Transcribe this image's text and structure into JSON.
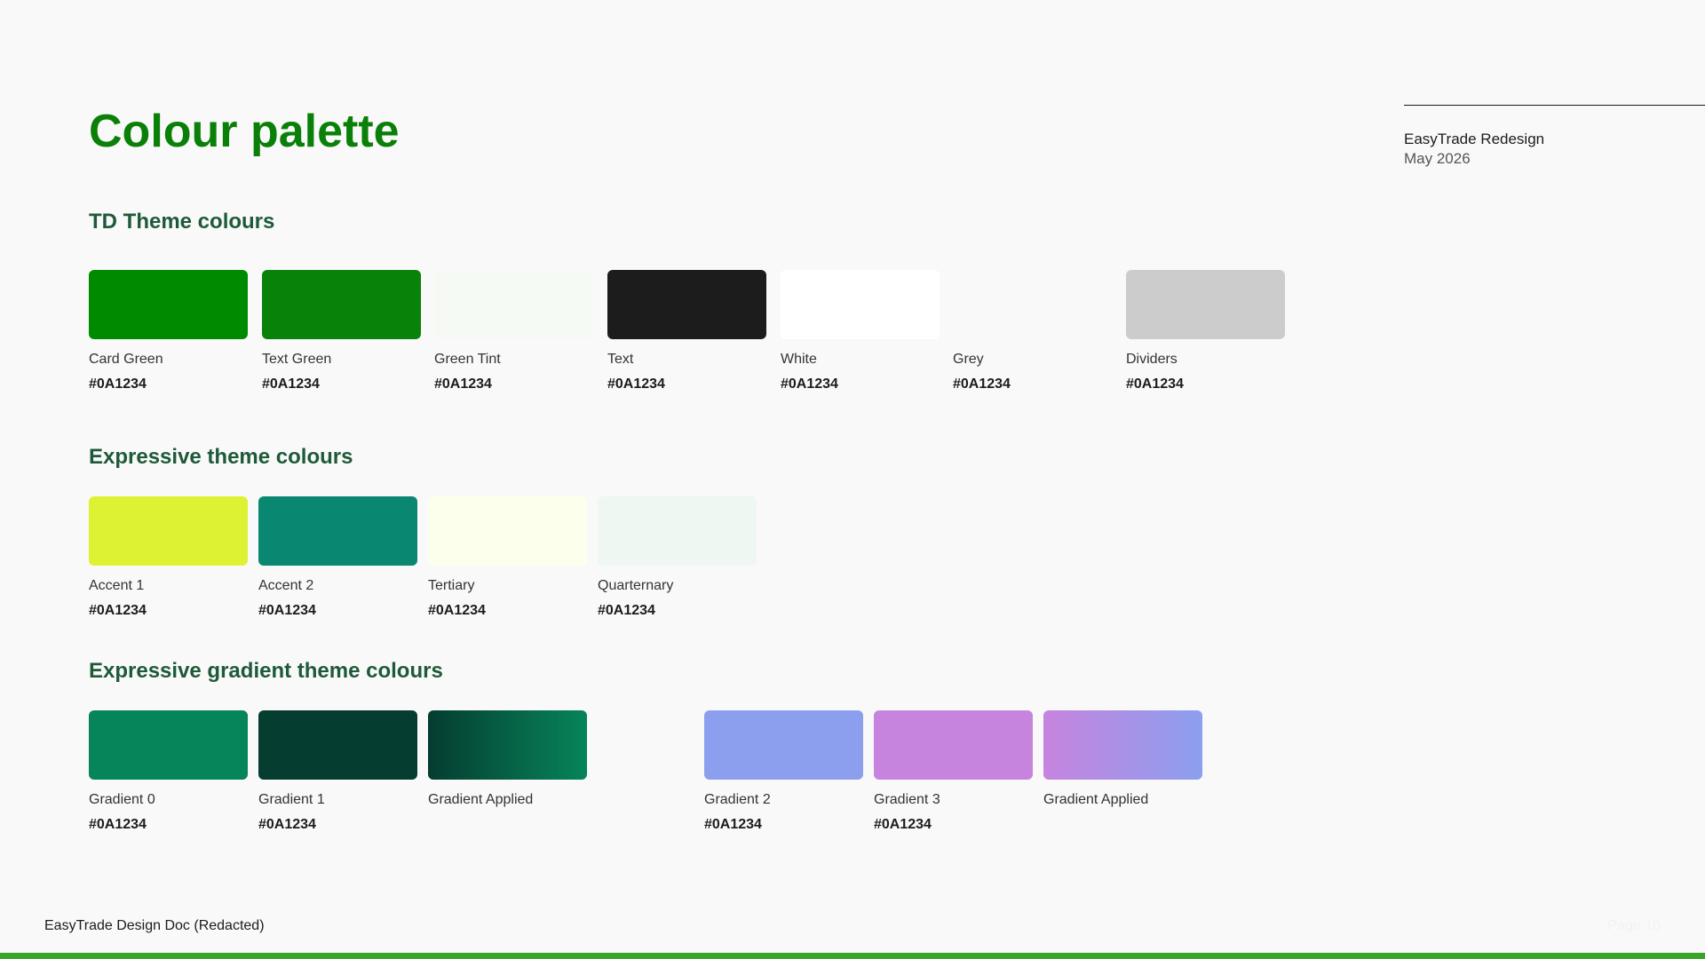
{
  "title": "Colour palette",
  "meta": {
    "project": "EasyTrade Redesign",
    "date": "May 2026"
  },
  "sections": [
    {
      "title": "TD Theme colours",
      "swatches": [
        {
          "name": "Card Green",
          "hex": "#0A1234",
          "color": "#008a00"
        },
        {
          "name": "Text Green",
          "hex": "#0A1234",
          "color": "#088208"
        },
        {
          "name": "Green Tint",
          "hex": "#0A1234",
          "color": "#f6faf4"
        },
        {
          "name": "Text",
          "hex": "#0A1234",
          "color": "#1c1c1c"
        },
        {
          "name": "White",
          "hex": "#0A1234",
          "color": "#ffffff"
        },
        {
          "name": "Grey",
          "hex": "#0A1234",
          "color": "#f9f9f9"
        },
        {
          "name": "Dividers",
          "hex": "#0A1234",
          "color": "#cccccc"
        }
      ]
    },
    {
      "title": "Expressive theme colours",
      "swatches": [
        {
          "name": "Accent 1",
          "hex": "#0A1234",
          "color": "#ddf233"
        },
        {
          "name": "Accent 2",
          "hex": "#0A1234",
          "color": "#0a8771"
        },
        {
          "name": "Tertiary",
          "hex": "#0A1234",
          "color": "#fbffec"
        },
        {
          "name": "Quarternary",
          "hex": "#0A1234",
          "color": "#eef7f2"
        }
      ]
    },
    {
      "title": "Expressive gradient theme colours",
      "swatches": [
        {
          "name": "Gradient 0",
          "hex": "#0A1234",
          "color": "#06845a"
        },
        {
          "name": "Gradient 1",
          "hex": "#0A1234",
          "color": "#053d30"
        },
        {
          "name": "Gradient Applied",
          "hex": "",
          "color": "linear-gradient(90deg, #053d30 0%, #06845a 100%)"
        },
        {
          "name": "Gradient 2",
          "hex": "#0A1234",
          "color": "#8c9fef"
        },
        {
          "name": "Gradient 3",
          "hex": "#0A1234",
          "color": "#c684de"
        },
        {
          "name": "Gradient Applied",
          "hex": "",
          "color": "linear-gradient(90deg, #c684de 0%, #8c9fef 100%)"
        }
      ]
    }
  ],
  "footer": {
    "doc_title": "EasyTrade Design Doc (Redacted)",
    "page": "Page 10"
  }
}
